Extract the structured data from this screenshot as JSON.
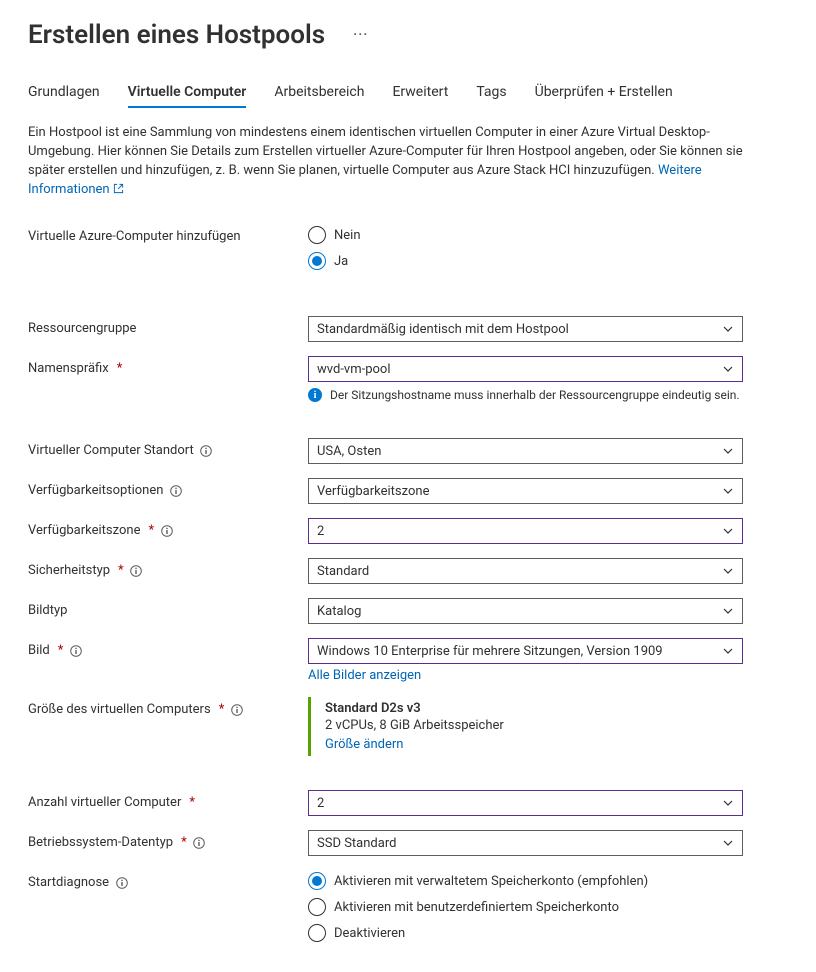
{
  "title": "Erstellen eines Hostpools",
  "tabs": [
    {
      "label": "Grundlagen",
      "active": false
    },
    {
      "label": "Virtuelle Computer",
      "active": true
    },
    {
      "label": "Arbeitsbereich",
      "active": false
    },
    {
      "label": "Erweitert",
      "active": false
    },
    {
      "label": "Tags",
      "active": false
    },
    {
      "label": "Überprüfen + Erstellen",
      "active": false
    }
  ],
  "description": "Ein Hostpool ist eine Sammlung von mindestens einem identischen virtuellen Computer in einer Azure Virtual Desktop-Umgebung. Hier können Sie Details zum Erstellen virtueller Azure-Computer für Ihren Hostpool angeben, oder Sie können sie später erstellen und hinzufügen, z. B. wenn Sie planen, virtuelle Computer aus Azure Stack HCI hinzuzufügen.",
  "learn_more": "Weitere Informationen",
  "fields": {
    "add_vm": {
      "label": "Virtuelle Azure-Computer hinzufügen",
      "options": [
        "Nein",
        "Ja"
      ],
      "selected": 1
    },
    "resource_group": {
      "label": "Ressourcengruppe",
      "value": "Standardmäßig identisch mit dem Hostpool"
    },
    "name_prefix": {
      "label": "Namenspräfix",
      "value": "wvd-vm-pool",
      "helper": "Der Sitzungshostname muss innerhalb der Ressourcengruppe eindeutig sein."
    },
    "location": {
      "label": "Virtueller Computer Standort",
      "value": "USA, Osten"
    },
    "avail_options": {
      "label": "Verfügbarkeitsoptionen",
      "value": "Verfügbarkeitszone"
    },
    "avail_zone": {
      "label": "Verfügbarkeitszone",
      "value": "2"
    },
    "security_type": {
      "label": "Sicherheitstyp",
      "value": "Standard"
    },
    "image_type": {
      "label": "Bildtyp",
      "value": "Katalog"
    },
    "image": {
      "label": "Bild",
      "value": "Windows 10 Enterprise für mehrere Sitzungen, Version 1909",
      "all_link": "Alle Bilder anzeigen"
    },
    "vm_size": {
      "label": "Größe des virtuellen Computers",
      "title": "Standard D2s v3",
      "sub": "2 vCPUs, 8 GiB Arbeitsspeicher",
      "link": "Größe ändern"
    },
    "vm_count": {
      "label": "Anzahl virtueller Computer",
      "value": "2"
    },
    "os_disk": {
      "label": "Betriebssystem-Datentyp",
      "value": "SSD Standard"
    },
    "boot_diag": {
      "label": "Startdiagnose",
      "options": [
        "Aktivieren mit verwaltetem Speicherkonto (empfohlen)",
        "Aktivieren mit benutzerdefiniertem Speicherkonto",
        "Deaktivieren"
      ],
      "selected": 0
    }
  }
}
